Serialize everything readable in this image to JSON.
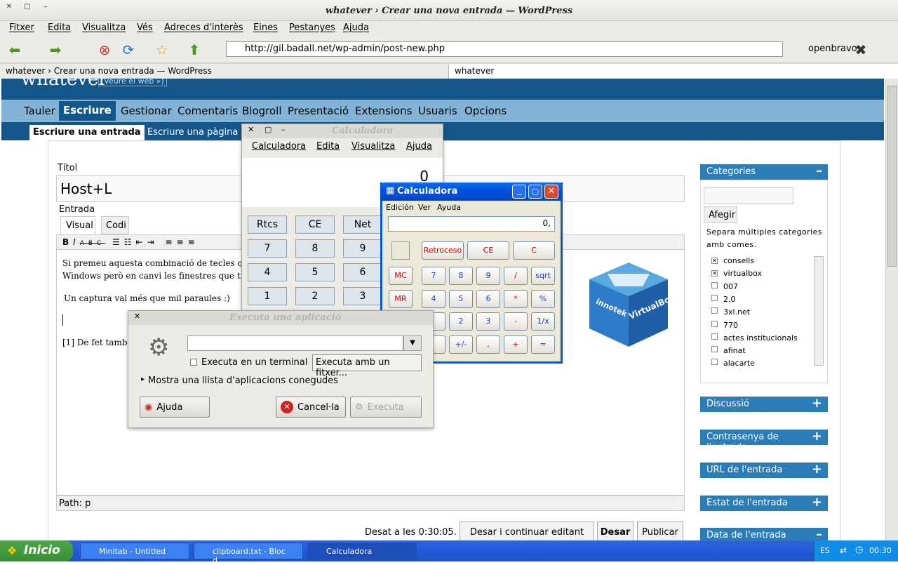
{
  "window": {
    "title": "whatever › Crear una nova entrada — WordPress"
  },
  "menu": [
    "Fitxer",
    "Edita",
    "Visualitza",
    "Vés",
    "Adreces d'interès",
    "Eines",
    "Pestanyes",
    "Ajuda"
  ],
  "nav": {
    "url": "http://gil.badall.net/wp-admin/post-new.php",
    "search_engine": "openbravo"
  },
  "tabs": [
    "whatever › Crear una nova entrada — WordPress",
    "whatever"
  ],
  "wp": {
    "blog_name": "whatever",
    "view_site": "(Veure el web »)",
    "main_nav": [
      "Tauler",
      "Escriure",
      "Gestionar",
      "Comentaris",
      "Blogroll",
      "Presentació",
      "Extensions",
      "Usuaris",
      "Opcions"
    ],
    "sub_nav": [
      "Escriure una entrada",
      "Escriure una pàgina"
    ],
    "title_label": "Títol",
    "title_value": "Host+L",
    "entry_label": "Entrada",
    "tab_visual": "Visual",
    "tab_code": "Codi",
    "content": [
      "Si premeu aquesta combinació de tecles quan e",
      "Windows però en canvi les finestres que tingue",
      "Un captura val més que mil paraules :)",
      "[1] De fet també"
    ],
    "path": "Path: p",
    "saved": "Desat a les 0:30:05.",
    "btn_save_continue": "Desar i continuar editant",
    "btn_save": "Desar",
    "btn_publish": "Publicar",
    "categories": {
      "title": "Categories",
      "add": "Afegir",
      "hint": "Separa múltiples categories amb comes.",
      "items": [
        {
          "name": "consells",
          "checked": true
        },
        {
          "name": "virtualbox",
          "checked": true
        },
        {
          "name": "007",
          "checked": false
        },
        {
          "name": "2.0",
          "checked": false
        },
        {
          "name": "3xl.net",
          "checked": false
        },
        {
          "name": "770",
          "checked": false
        },
        {
          "name": "actes institucionals",
          "checked": false
        },
        {
          "name": "afinat",
          "checked": false
        },
        {
          "name": "alacarte",
          "checked": false
        }
      ]
    },
    "boxes": [
      "Discussió",
      "Contrasenya de l'entrada",
      "URL de l'entrada",
      "Estat de l'entrada",
      "Data de l'entrada"
    ]
  },
  "gcalc": {
    "title": "Calculadora",
    "menu": [
      "Calculadora",
      "Edita",
      "Visualitza",
      "Ajuda"
    ],
    "display": "0",
    "buttons": [
      "Rtcs",
      "CE",
      "Net",
      "7",
      "8",
      "9",
      "4",
      "5",
      "6",
      "1",
      "2",
      "3"
    ]
  },
  "xpcalc": {
    "title": "Calculadora",
    "menu": [
      "Edición",
      "Ver",
      "Ayuda"
    ],
    "display": "0,",
    "top": [
      "Retroceso",
      "CE",
      "C"
    ],
    "rows": [
      [
        "MC",
        "7",
        "8",
        "9",
        "/",
        "sqrt"
      ],
      [
        "MR",
        "4",
        "5",
        "6",
        "*",
        "%"
      ],
      [
        "",
        "",
        "2",
        "3",
        "-",
        "1/x"
      ],
      [
        "",
        "+/-",
        ",",
        "+",
        "="
      ]
    ]
  },
  "run": {
    "title": "Executa una aplicació",
    "terminal": "Executa en un terminal",
    "with_file": "Executa amb un fitxer...",
    "known": "Mostra una llista d'aplicacions conegudes",
    "help": "Ajuda",
    "cancel": "Cancel·la",
    "run": "Executa"
  },
  "vbox": {
    "brand": "innotek",
    "product": "VirtualBox"
  },
  "taskbar": {
    "start": "Inicio",
    "tasks": [
      "Minitab - Untitled",
      "clipboard.txt - Bloc d...",
      "Calculadora"
    ],
    "lang": "ES",
    "clock": "00:30"
  }
}
